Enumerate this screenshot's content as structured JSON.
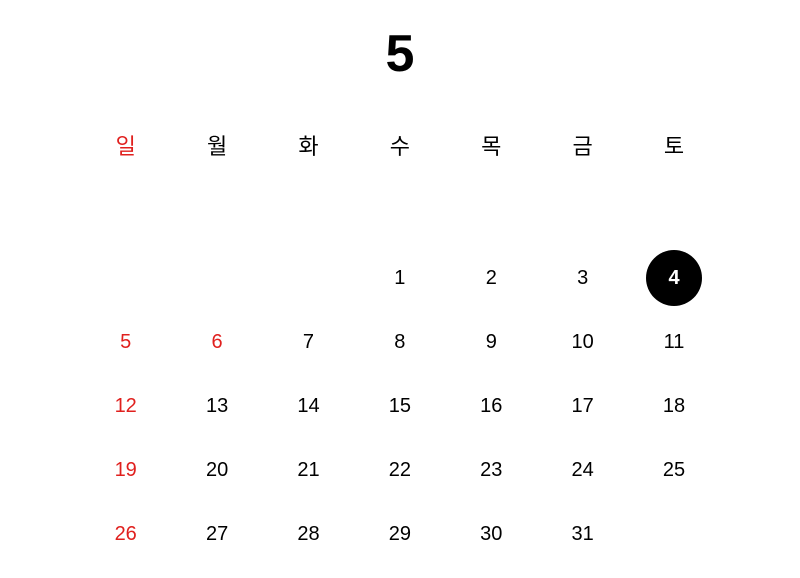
{
  "calendar": {
    "month_label": "5",
    "weekdays": [
      "일",
      "월",
      "화",
      "수",
      "목",
      "금",
      "토"
    ],
    "first_weekday_index": 3,
    "days": [
      "1",
      "2",
      "3",
      "4",
      "5",
      "6",
      "7",
      "8",
      "9",
      "10",
      "11",
      "12",
      "13",
      "14",
      "15",
      "16",
      "17",
      "18",
      "19",
      "20",
      "21",
      "22",
      "23",
      "24",
      "25",
      "26",
      "27",
      "28",
      "29",
      "30",
      "31"
    ],
    "selected_day": "4",
    "holidays": [
      "5",
      "6"
    ],
    "colors": {
      "sunday_holiday": "#e0201e",
      "default": "#000000",
      "selected_bg": "#000000",
      "selected_fg": "#ffffff"
    }
  }
}
